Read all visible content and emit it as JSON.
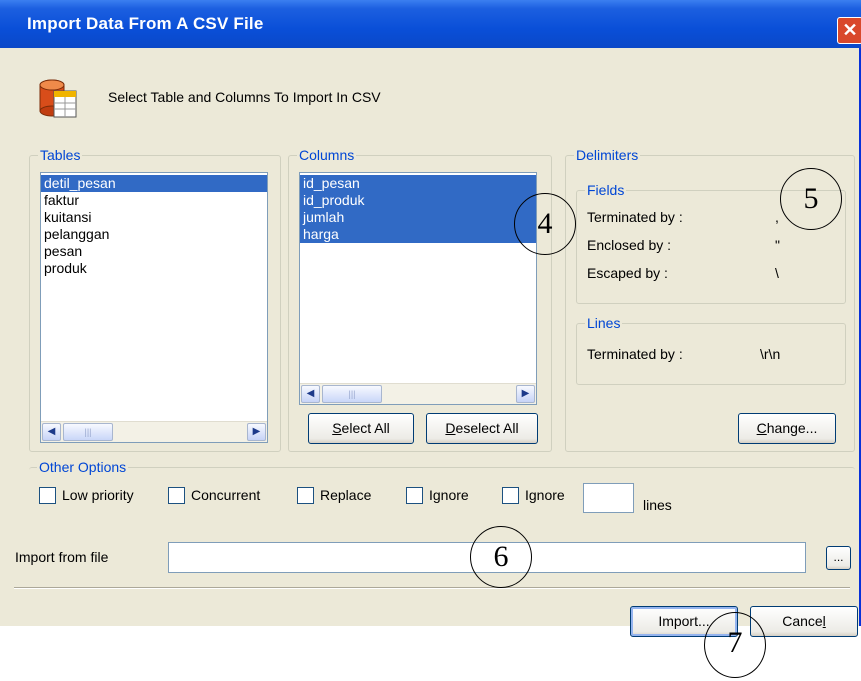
{
  "window": {
    "title": "Import Data From A CSV File",
    "close_glyph": "✕",
    "header_text": "Select Table and Columns To Import In CSV",
    "header_icon": "database-table-icon"
  },
  "tables": {
    "legend": "Tables",
    "items": [
      "detil_pesan",
      "faktur",
      "kuitansi",
      "pelanggan",
      "pesan",
      "produk"
    ],
    "selected": "detil_pesan"
  },
  "columns": {
    "legend": "Columns",
    "items": [
      "id_pesan",
      "id_produk",
      "jumlah",
      "harga"
    ],
    "select_all": "Select All",
    "deselect_all": "Deselect All"
  },
  "delimiters": {
    "legend": "Delimiters",
    "fields_legend": "Fields",
    "terminated_by_label": "Terminated by :",
    "terminated_by_value": ",",
    "enclosed_by_label": "Enclosed by :",
    "enclosed_by_value": "\"",
    "escaped_by_label": "Escaped by :",
    "escaped_by_value": "\\",
    "lines_legend": "Lines",
    "lines_terminated_label": "Terminated by :",
    "lines_terminated_value": "\\r\\n",
    "change_button": "Change..."
  },
  "other_options": {
    "legend": "Other Options",
    "low_priority": "Low priority",
    "concurrent": "Concurrent",
    "replace": "Replace",
    "ignore1": "Ignore",
    "ignore2": "Ignore",
    "lines": "lines",
    "ignore_lines_value": ""
  },
  "import_file": {
    "label": "Import from file",
    "value": "",
    "browse": "..."
  },
  "buttons": {
    "import": "Import...",
    "cancel": "Cancel"
  },
  "callouts": [
    "4",
    "5",
    "6",
    "7"
  ],
  "colors": {
    "title_bar": "#0a4fd8",
    "selection": "#316ac5",
    "legend_text": "#0046d5",
    "dialog_bg": "#ece9d8"
  }
}
